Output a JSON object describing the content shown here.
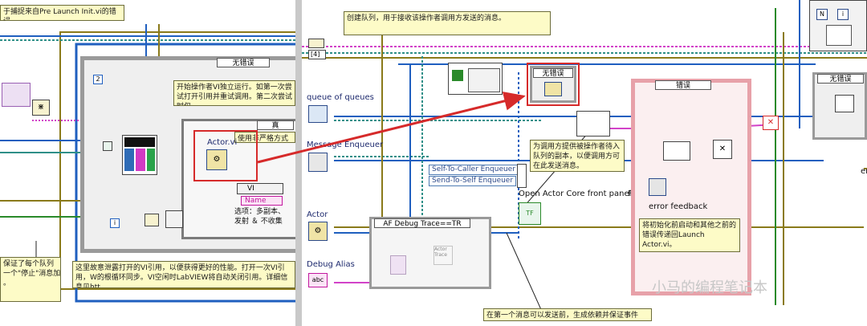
{
  "left_pane": {
    "top_comment": "于捕捉来自Pre Launch Init.vi的错误。",
    "case_selector_no_error": "无错误",
    "start_comment": "开始操作者VI独立运行。如第一次尝试打开引用并重试调用。第二次尝试时仅",
    "array_index_constant": "2",
    "true_case_selector": "真",
    "actor_vi_label": "Actor.vi",
    "nonstrict_comment": "使用非严格方式解",
    "name_chip": "Name",
    "vi_chip": "VI",
    "options_text": "选项：多副本、\n发射 ＆ 不收集",
    "integer_constant": "i",
    "bottom_comment": "这里故意泄露打开的VI引用，以便获得更好的性能。打开一次VI引用，W的根循环同步。VI空闲时LabVIEW将自动关闭引用。详细信息见htt",
    "side_comment": "保证了每个队列\n一个\"停止\"消息加\n。"
  },
  "right_pane": {
    "top_comment": "创建队列，用于接收该操作者调用方发送的消息。",
    "index_constant": "[4]",
    "queue_of_queues_label": "queue of queues",
    "message_enqueuer_label": "Message Enqueuer",
    "actor_label": "Actor",
    "debug_alias_label": "Debug Alias",
    "case_no_error_1": "无错误",
    "case_error": "错误",
    "case_no_error_2": "无错误",
    "caller_comment": "为调用方提供被操作者待入队列的副本，以便调用方可在此发送消息。",
    "self_to_caller": "Self-To-Caller Enqueuer",
    "send_to_self": "Send-To-Self Enqueuer",
    "open_front_panel": "Open Actor Core front panel?",
    "front_panel_suffix": "F",
    "tf_constant": "TF",
    "debug_trace_selector": "AF Debug Trace==TR",
    "actor_trace_label": "Actor\nTrace",
    "error_feedback_label": "error feedback",
    "init_error_comment": "将初始化前启动和其他之前的错误传递回Launch Actor.vi。",
    "bottom_comment": "在第一个消息可以发送前，生成依赖并保证事件",
    "right_edge_label": "er",
    "abc_constant": "abc",
    "tiny_n_constant": "N",
    "tiny_i_constant": "i"
  },
  "watermark": "小马的编程笔记本",
  "colors": {
    "wire_blue": "#1f5fbf",
    "wire_teal": "#2f8f88",
    "wire_pink": "#d243c8",
    "wire_olive": "#8a7a1a",
    "wire_green": "#2a8a2a",
    "error_red": "#d62a2a",
    "comment_bg": "#fdfbc7"
  }
}
